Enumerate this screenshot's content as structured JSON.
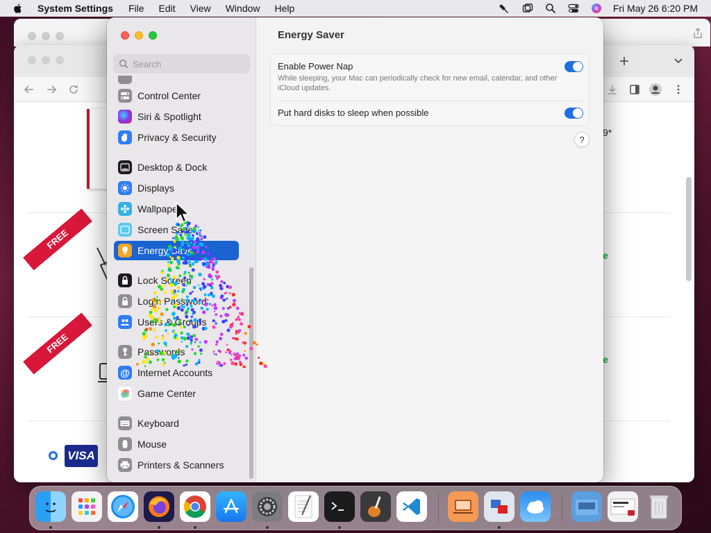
{
  "menubar": {
    "app_name": "System Settings",
    "menus": [
      "File",
      "Edit",
      "View",
      "Window",
      "Help"
    ],
    "clock": "Fri May 26  6:20 PM"
  },
  "settings": {
    "search_placeholder": "Search",
    "sidebar_items": [
      {
        "label": "Control Center",
        "icon": "control-center-icon",
        "color": "#8e8e93"
      },
      {
        "label": "Siri & Spotlight",
        "icon": "siri-icon",
        "color": "#5a2ca0"
      },
      {
        "label": "Privacy & Security",
        "icon": "hand-icon",
        "color": "#2f7cf6"
      },
      {
        "label": "Desktop & Dock",
        "icon": "dock-icon",
        "color": "#1c1c1e"
      },
      {
        "label": "Displays",
        "icon": "sun-icon",
        "color": "#2f7cf6"
      },
      {
        "label": "Wallpaper",
        "icon": "wallpaper-icon",
        "color": "#36b0e8"
      },
      {
        "label": "Screen Saver",
        "icon": "screen-saver-icon",
        "color": "#5cc8f0"
      },
      {
        "label": "Energy Saver",
        "icon": "bulb-icon",
        "color": "#f5a623",
        "selected": true
      },
      {
        "label": "Lock Screen",
        "icon": "lock-icon",
        "color": "#1c1c1e"
      },
      {
        "label": "Login Password",
        "icon": "login-lock-icon",
        "color": "#8e8e93"
      },
      {
        "label": "Users & Groups",
        "icon": "users-icon",
        "color": "#2f7cf6"
      },
      {
        "label": "Passwords",
        "icon": "key-icon",
        "color": "#8e8e93"
      },
      {
        "label": "Internet Accounts",
        "icon": "at-icon",
        "color": "#2f7cf6"
      },
      {
        "label": "Game Center",
        "icon": "game-center-icon",
        "color": "#ffffff"
      },
      {
        "label": "Keyboard",
        "icon": "keyboard-icon",
        "color": "#8e8e93"
      },
      {
        "label": "Mouse",
        "icon": "mouse-icon",
        "color": "#8e8e93"
      },
      {
        "label": "Printers & Scanners",
        "icon": "printer-icon",
        "color": "#8e8e93"
      }
    ],
    "main_title": "Energy Saver",
    "rows": [
      {
        "title": "Enable Power Nap",
        "description": "While sleeping, your Mac can periodically check for new email, calendar, and other iCloud updates.",
        "enabled": true
      },
      {
        "title": "Put hard disks to sleep when possible",
        "description": "",
        "enabled": true
      }
    ],
    "help_label": "?"
  },
  "browser": {
    "ribbon_text": "FREE",
    "visa_label": "VISA",
    "price_partial": "9*",
    "green_partial": "e"
  },
  "dock": {
    "apps": [
      "finder",
      "launchpad",
      "safari",
      "firefox",
      "chrome",
      "app-store",
      "system-settings",
      "textedit",
      "terminal",
      "garageband",
      "vscode",
      "remote-desktop",
      "migration",
      "weather",
      "downloads",
      "screenshot",
      "trash"
    ]
  },
  "colors": {
    "accent": "#1a63d1",
    "toggle_on": "#1f6fe0",
    "close": "#fe5f57",
    "minimize": "#febc2e",
    "maximize": "#28c840"
  }
}
